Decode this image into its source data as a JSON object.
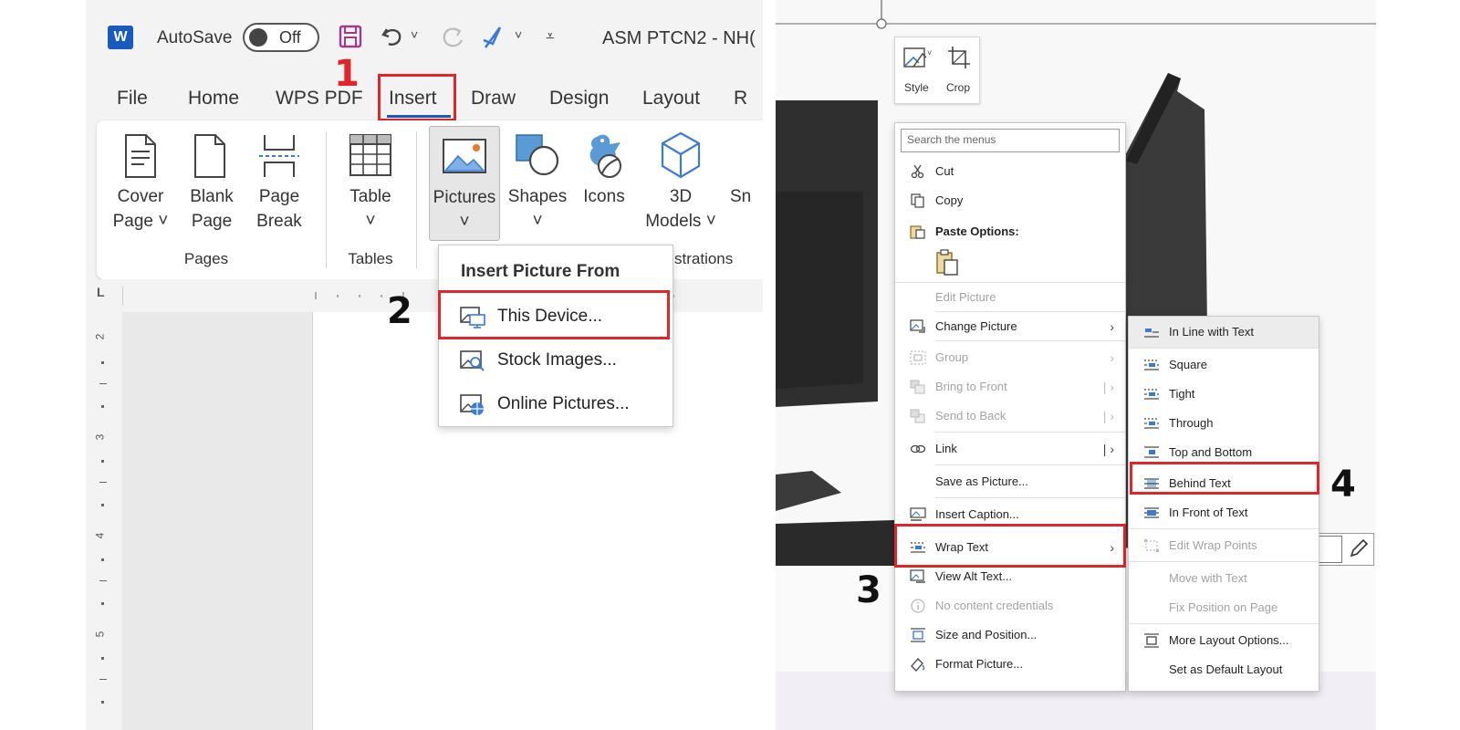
{
  "left": {
    "title_bar": {
      "autosave_label": "AutoSave",
      "toggle_state": "Off",
      "doc_title": "ASM PTCN2 - NH("
    },
    "tabs": [
      "File",
      "Home",
      "WPS PDF",
      "Insert",
      "Draw",
      "Design",
      "Layout",
      "R"
    ],
    "ribbon": {
      "cover_page": [
        "Cover",
        "Page ˅"
      ],
      "blank_page": [
        "Blank",
        "Page"
      ],
      "page_break": [
        "Page",
        "Break"
      ],
      "table": [
        "Table",
        "˅"
      ],
      "pictures": [
        "Pictures",
        "˅"
      ],
      "shapes": [
        "Shapes",
        "˅"
      ],
      "icons": "Icons",
      "models_3d": [
        "3D",
        "Models ˅"
      ],
      "smartart_partial": "Sn",
      "groups": [
        "Pages",
        "Tables",
        "llustrations"
      ]
    },
    "insert_picture_menu": {
      "header": "Insert Picture From",
      "items": [
        "This Device...",
        "Stock Images...",
        "Online Pictures..."
      ]
    },
    "ruler_numbers": [
      "2",
      "3",
      "4",
      "5"
    ],
    "ruler_tab_marker": "L"
  },
  "right": {
    "picture_toolbar": {
      "style_label": "Style",
      "crop_label": "Crop"
    },
    "context_menu": {
      "search_placeholder": "Search the menus",
      "items": {
        "cut": "Cut",
        "copy": "Copy",
        "paste_options": "Paste Options:",
        "edit_picture": "Edit Picture",
        "change_picture": "Change Picture",
        "group": "Group",
        "bring_to_front": "Bring to Front",
        "send_to_back": "Send to Back",
        "link": "Link",
        "save_as_picture": "Save as Picture...",
        "insert_caption": "Insert Caption...",
        "wrap_text": "Wrap Text",
        "view_alt_text": "View Alt Text...",
        "no_content_credentials": "No content credentials",
        "size_and_position": "Size and Position...",
        "format_picture": "Format Picture..."
      }
    },
    "wrap_submenu": {
      "items": {
        "in_line": "In Line with Text",
        "square": "Square",
        "tight": "Tight",
        "through": "Through",
        "top_bottom": "Top and Bottom",
        "behind_text": "Behind Text",
        "in_front": "In Front of Text",
        "edit_wrap_points": "Edit Wrap Points",
        "move_with_text": "Move with Text",
        "fix_position": "Fix Position on Page",
        "more_layout": "More Layout Options...",
        "set_default": "Set as Default Layout"
      }
    }
  },
  "steps": [
    "1",
    "2",
    "3",
    "4"
  ],
  "colors": {
    "highlight_red": "#e0262b",
    "word_blue": "#185abd",
    "save_purple": "#a4378f"
  }
}
